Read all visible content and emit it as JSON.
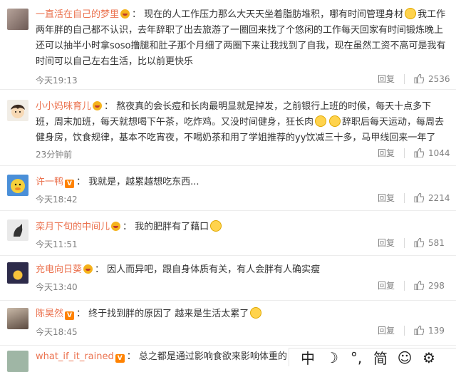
{
  "comments": [
    {
      "username": "一直活在自己的梦里",
      "badge": "crown",
      "text": "现在的人工作压力那么大天天坐着脂肪堆积，哪有时间管理身材",
      "text2": "我工作两年胖的自己都不认识，去年辞职了出去旅游了一圈回来找了个悠闲的工作每天回家有时间锻炼晚上还可以抽半小时拿soso撸腿和肚子那个月细了两圈下来让我找到了自我，现在虽然工资不高可是我有时间可以自己左右生活，比以前更快乐",
      "time": "今天19:13",
      "reply": "回复",
      "likes": "2536"
    },
    {
      "username": "小小妈咪育儿",
      "badge": "crown",
      "text": "熬夜真的会长痘和长肉最明显就是掉发，之前银行上班的时候，每天十点多下班，周末加班，每天就想喝下午茶，吃炸鸡。又没时间健身，狂长肉",
      "text2": "辞职后每天运动，每周去健身房，饮食规律，基本不吃宵夜，不喝奶茶和用了学姐推荐的yy饮减三十多，马甲线回来一年了",
      "time": "23分钟前",
      "reply": "回复",
      "likes": "1044"
    },
    {
      "username": "许一鸭",
      "badge": "v",
      "text": "我就是，越累越想吃东西...",
      "time": "今天18:42",
      "reply": "回复",
      "likes": "2214"
    },
    {
      "username": "栾月下旬的中间儿",
      "badge": "crown",
      "text": "我的肥胖有了藉口",
      "time": "今天11:51",
      "reply": "回复",
      "likes": "581"
    },
    {
      "username": "充电向日葵",
      "badge": "crown",
      "text": "因人而异吧，跟自身体质有关，有人会胖有人确实瘦",
      "time": "今天13:40",
      "reply": "回复",
      "likes": "298"
    },
    {
      "username": "陈昊然",
      "badge": "v",
      "text": "终于找到胖的原因了 越来是生活太累了",
      "time": "今天18:45",
      "reply": "回复",
      "likes": "139"
    },
    {
      "username": "what_if_it_rained",
      "badge": "v",
      "text": "总之都是通过影响食欲来影响体重的，管住嘴"
    }
  ],
  "toolbar": {
    "items": [
      "中",
      "☽",
      "°,",
      "简",
      "☺",
      "⚙"
    ]
  }
}
